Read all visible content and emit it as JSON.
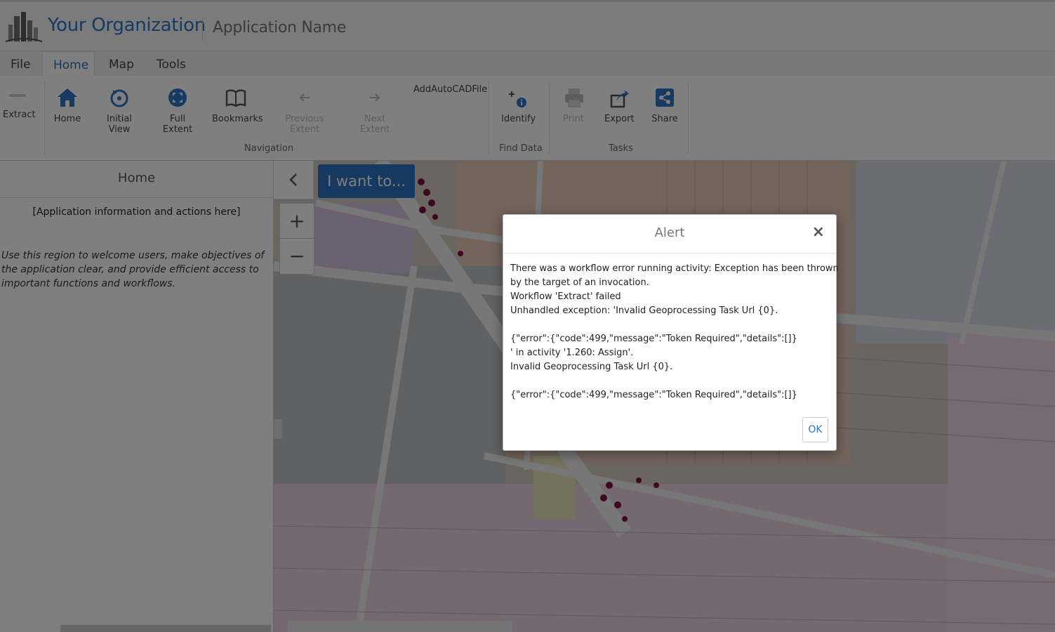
{
  "header": {
    "org_title": "Your Organization",
    "app_name": "Application Name"
  },
  "menu": {
    "tabs": [
      {
        "label": "File"
      },
      {
        "label": "Home"
      },
      {
        "label": "Map"
      },
      {
        "label": "Tools"
      }
    ],
    "active_tab": "Home"
  },
  "ribbon": {
    "extract_label": "Extract",
    "buttons": {
      "home": "Home",
      "initial_view": "Initial View",
      "full_extent": "Full Extent",
      "bookmarks": "Bookmarks",
      "previous_extent": "Previous Extent",
      "next_extent": "Next Extent",
      "identify": "Identify",
      "print": "Print",
      "export": "Export",
      "share": "Share"
    },
    "extra_label": "AddAutoCADFile",
    "groups": {
      "navigation": "Navigation",
      "find_data": "Find Data",
      "tasks": "Tasks"
    },
    "colors": {
      "accent": "#2d74c4",
      "disabled": "#bbbbbb"
    }
  },
  "left_panel": {
    "title": "Home",
    "info": "[Application information and actions here]",
    "description": "Use this region to welcome users, make objectives of the application clear, and provide efficient access to important functions and workflows."
  },
  "map": {
    "i_want_to": "I want to...",
    "zoom_in": "+",
    "zoom_out": "−"
  },
  "alert": {
    "title": "Alert",
    "close": "×",
    "lines": [
      "There was a workflow error running activity: Exception has been thrown",
      "by the target of an invocation.",
      "Workflow 'Extract' failed",
      "Unhandled exception: 'Invalid Geoprocessing Task Url {0}.",
      "",
      "{\"error\":{\"code\":499,\"message\":\"Token Required\",\"details\":[]}",
      "' in activity '1.260: Assign'.",
      "Invalid Geoprocessing Task Url {0}.",
      "",
      "{\"error\":{\"code\":499,\"message\":\"Token Required\",\"details\":[]}"
    ],
    "ok_label": "OK"
  }
}
